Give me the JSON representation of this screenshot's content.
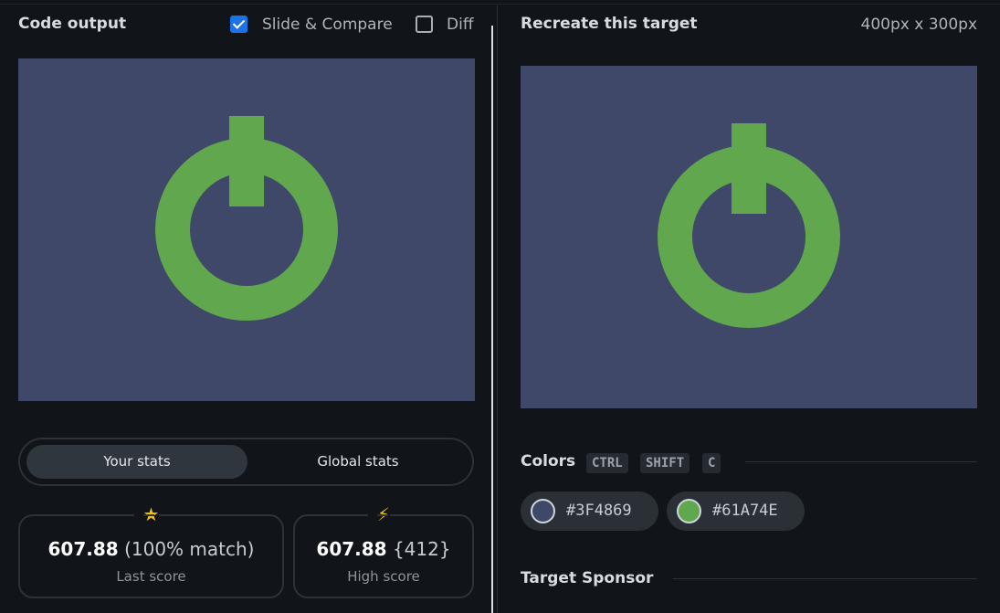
{
  "left_panel": {
    "title": "Code output",
    "slide_compare": {
      "label": "Slide & Compare",
      "checked": true
    },
    "diff": {
      "label": "Diff",
      "checked": false
    },
    "tabs": [
      {
        "label": "Your stats",
        "active": true
      },
      {
        "label": "Global stats",
        "active": false
      }
    ],
    "stats": {
      "last": {
        "score": "607.88",
        "extra": "(100% match)",
        "label": "Last score",
        "icon": "star-icon"
      },
      "high": {
        "score": "607.88",
        "extra": "{412}",
        "label": "High score",
        "icon": "lightning-icon"
      }
    }
  },
  "right_panel": {
    "title": "Recreate this target",
    "dimensions": "400px x 300px",
    "colors_title": "Colors",
    "shortcut_keys": [
      "CTRL",
      "SHIFT",
      "C"
    ],
    "colors": [
      {
        "hex": "#3F4869",
        "label": "#3F4869"
      },
      {
        "hex": "#61A74E",
        "label": "#61A74E"
      }
    ],
    "sponsor_title": "Target Sponsor"
  },
  "palette": {
    "background": "#3F4869",
    "shape": "#61A74E",
    "accent": "#1A73E8",
    "star": "#F2C40F"
  }
}
